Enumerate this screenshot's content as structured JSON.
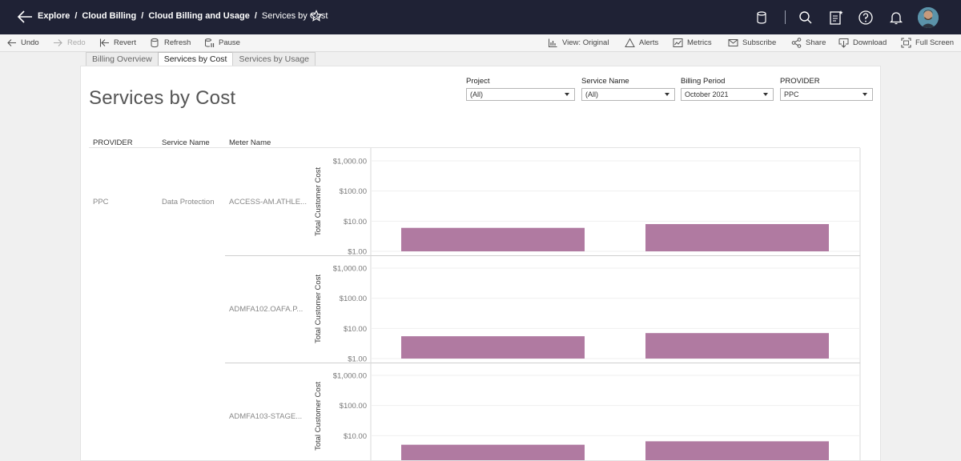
{
  "breadcrumbs": [
    {
      "label": "Explore"
    },
    {
      "label": "Cloud Billing"
    },
    {
      "label": "Cloud Billing and Usage"
    },
    {
      "label": "Services by Cost"
    }
  ],
  "toolbar": {
    "undo": "Undo",
    "redo": "Redo",
    "revert": "Revert",
    "refresh": "Refresh",
    "pause": "Pause",
    "view": "View: Original",
    "alerts": "Alerts",
    "metrics": "Metrics",
    "subscribe": "Subscribe",
    "share": "Share",
    "download": "Download",
    "fullscreen": "Full Screen"
  },
  "tabs": [
    {
      "label": "Billing Overview",
      "active": false
    },
    {
      "label": "Services by Cost",
      "active": true
    },
    {
      "label": "Services by Usage",
      "active": false
    }
  ],
  "page_title": "Services by Cost",
  "filters": {
    "project": {
      "label": "Project",
      "value": "(All)"
    },
    "service_name": {
      "label": "Service Name",
      "value": "(All)"
    },
    "billing_period": {
      "label": "Billing Period",
      "value": "October 2021"
    },
    "provider": {
      "label": "PROVIDER",
      "value": "PPC"
    }
  },
  "table_headers": {
    "provider": "PROVIDER",
    "service_name": "Service Name",
    "meter_name": "Meter Name"
  },
  "rows": {
    "provider": "PPC",
    "service_name": "Data Protection"
  },
  "colors": {
    "bar": "#b07aa1",
    "topbar": "#1f2235"
  },
  "chart_data": {
    "type": "bar",
    "scale": "log",
    "ylabel": "Total Customer Cost",
    "ylim": [
      1,
      1000
    ],
    "yticks": [
      "$1,000.00",
      "$100.00",
      "$10.00",
      "$1.00"
    ],
    "panels": [
      {
        "meter_name": "ACCESS-AM.ATHLE...",
        "values": [
          6,
          8
        ]
      },
      {
        "meter_name": "ADMFA102.OAFA.P...",
        "values": [
          5.5,
          7
        ]
      },
      {
        "meter_name": "ADMFA103-STAGE...",
        "values": [
          5,
          6.5
        ]
      }
    ]
  }
}
